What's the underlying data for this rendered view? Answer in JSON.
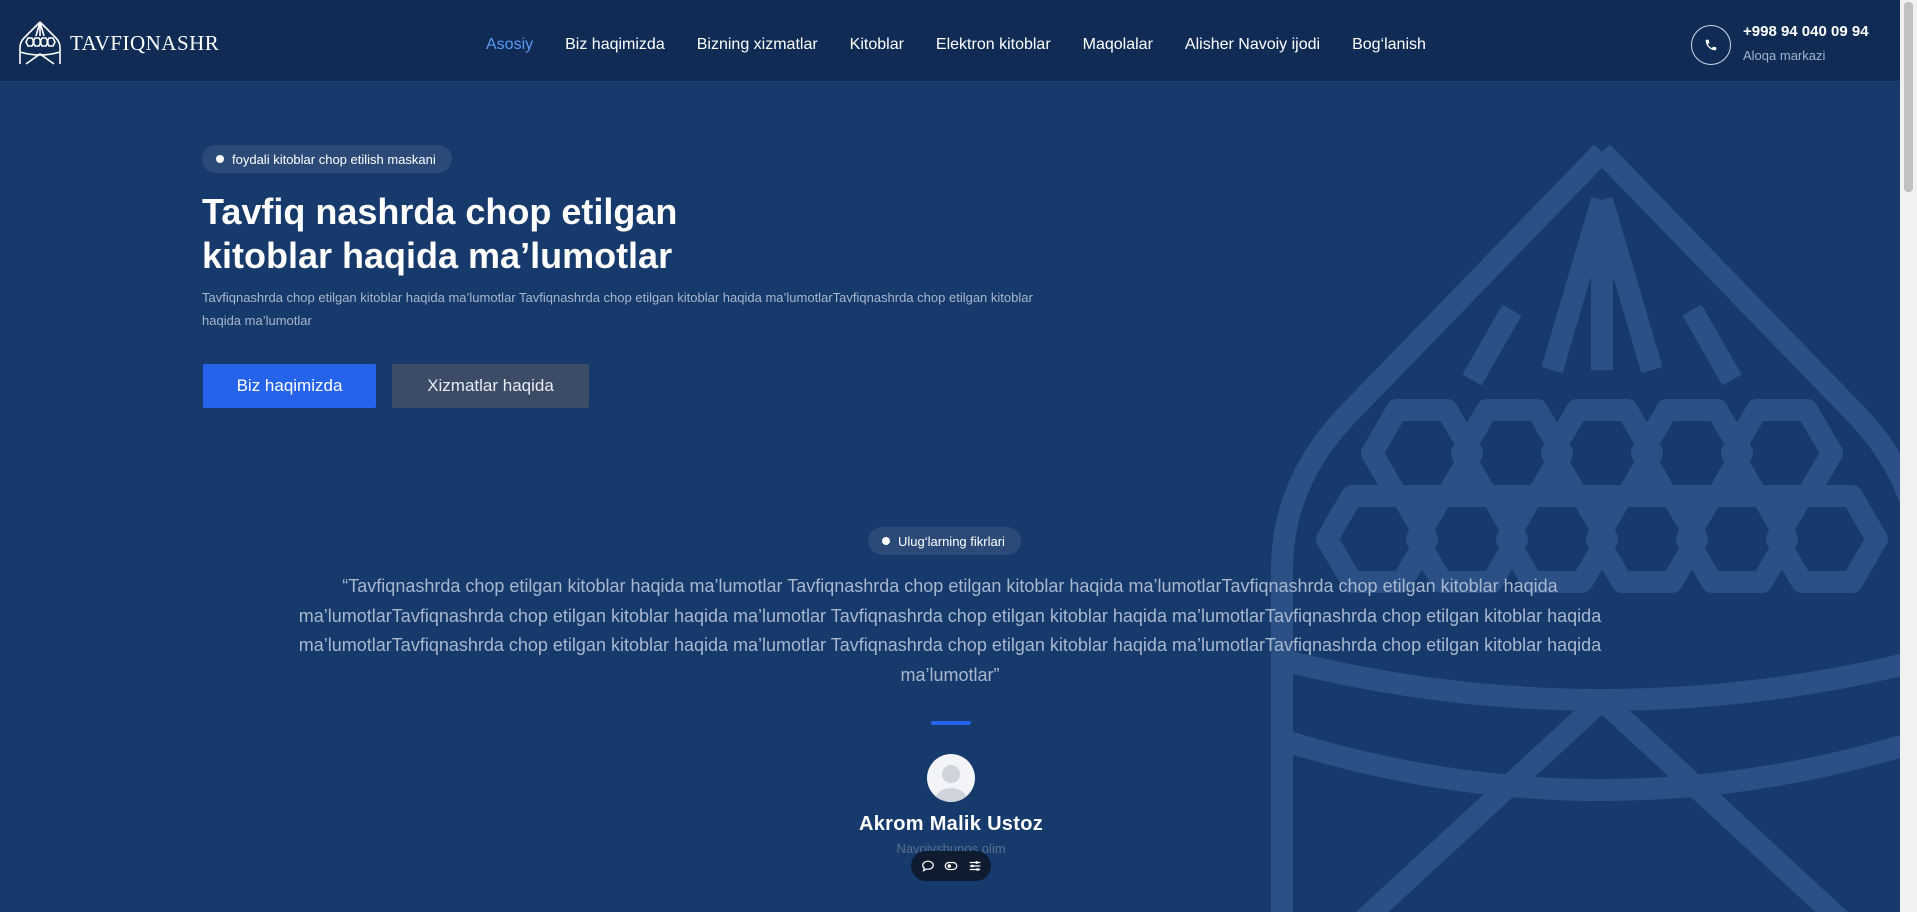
{
  "header": {
    "logo_text": "TAVFIQNASHR",
    "logo_icon": "dome-icon",
    "nav": [
      {
        "label": "Asosiy",
        "active": true
      },
      {
        "label": "Biz haqimizda"
      },
      {
        "label": "Bizning xizmatlar"
      },
      {
        "label": "Kitoblar"
      },
      {
        "label": "Elektron kitoblar"
      },
      {
        "label": "Maqolalar"
      },
      {
        "label": "Alisher Navoiy ijodi"
      },
      {
        "label": "Bog‘lanish"
      }
    ],
    "phone_icon": "phone-icon",
    "phone_number": "+998 94 040 09 94",
    "phone_label": "Aloqa markazi"
  },
  "hero": {
    "badge": "foydali kitoblar chop etilish maskani",
    "title_line1": "Tavfiq nashrda chop etilgan",
    "title_line2": "kitoblar haqida ma’lumotlar",
    "description": "Tavfiqnashrda chop etilgan kitoblar haqida ma’lumotlar Tavfiqnashrda chop etilgan kitoblar haqida ma’lumotlarTavfiqnashrda chop etilgan kitoblar haqida ma’lumotlar",
    "primary_button": "Biz haqimizda",
    "secondary_button": "Xizmatlar haqida"
  },
  "testimonial": {
    "badge": "Ulug‘larning fikrlari",
    "quote": "“Tavfiqnashrda chop etilgan kitoblar haqida ma’lumotlar Tavfiqnashrda chop etilgan kitoblar haqida ma’lumotlarTavfiqnashrda chop etilgan kitoblar haqida ma’lumotlarTavfiqnashrda chop etilgan kitoblar haqida ma’lumotlar Tavfiqnashrda chop etilgan kitoblar haqida ma’lumotlarTavfiqnashrda chop etilgan kitoblar haqida ma’lumotlarTavfiqnashrda chop etilgan kitoblar haqida ma’lumotlar Tavfiqnashrda chop etilgan kitoblar haqida ma’lumotlarTavfiqnashrda chop etilgan kitoblar haqida ma’lumotlar”",
    "author_name": "Akrom Malik Ustoz",
    "author_role": "Navoiyshunos olim",
    "avatar_icon": "user-avatar-icon"
  },
  "floating_toolbar": {
    "icons": [
      "comment-icon",
      "eye-toggle-icon",
      "settings-sliders-icon"
    ]
  },
  "colors": {
    "page_bg": "#163a6b",
    "header_bg": "#102c55",
    "accent": "#2563eb",
    "active_nav": "#5a9bf2"
  }
}
